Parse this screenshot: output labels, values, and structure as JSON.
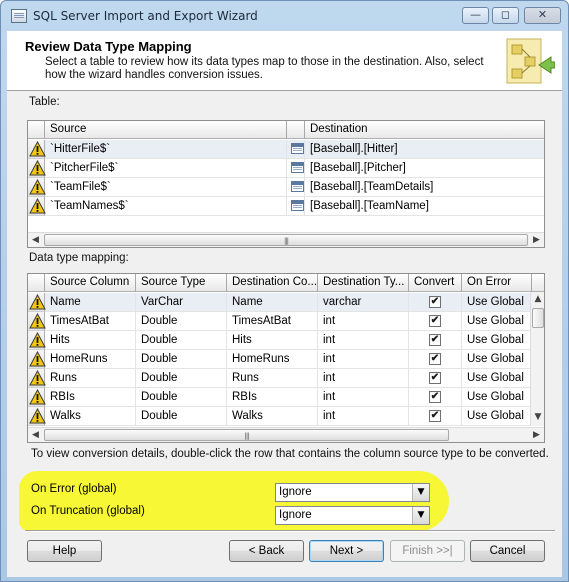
{
  "window": {
    "title": "SQL Server Import and Export Wizard"
  },
  "header": {
    "title": "Review Data Type Mapping",
    "description": "Select a table to review how its data types map to those in the destination. Also, select how the wizard handles conversion issues."
  },
  "tables": {
    "label": "Table:",
    "columns": [
      "Source",
      "Destination"
    ],
    "rows": [
      {
        "source": "`HitterFile$`",
        "destination": "[Baseball].[Hitter]",
        "warning": true
      },
      {
        "source": "`PitcherFile$`",
        "destination": "[Baseball].[Pitcher]",
        "warning": true
      },
      {
        "source": "`TeamFile$`",
        "destination": "[Baseball].[TeamDetails]",
        "warning": true
      },
      {
        "source": "`TeamNames$`",
        "destination": "[Baseball].[TeamName]",
        "warning": true
      }
    ]
  },
  "mapping": {
    "label": "Data type mapping:",
    "columns": [
      "Source Column",
      "Source Type",
      "Destination Co...",
      "Destination Ty...",
      "Convert",
      "On Error"
    ],
    "rows": [
      {
        "source_column": "Name",
        "source_type": "VarChar",
        "dest_column": "Name",
        "dest_type": "varchar",
        "convert": true,
        "on_error": "Use Global"
      },
      {
        "source_column": "TimesAtBat",
        "source_type": "Double",
        "dest_column": "TimesAtBat",
        "dest_type": "int",
        "convert": true,
        "on_error": "Use Global"
      },
      {
        "source_column": "Hits",
        "source_type": "Double",
        "dest_column": "Hits",
        "dest_type": "int",
        "convert": true,
        "on_error": "Use Global"
      },
      {
        "source_column": "HomeRuns",
        "source_type": "Double",
        "dest_column": "HomeRuns",
        "dest_type": "int",
        "convert": true,
        "on_error": "Use Global"
      },
      {
        "source_column": "Runs",
        "source_type": "Double",
        "dest_column": "Runs",
        "dest_type": "int",
        "convert": true,
        "on_error": "Use Global"
      },
      {
        "source_column": "RBIs",
        "source_type": "Double",
        "dest_column": "RBIs",
        "dest_type": "int",
        "convert": true,
        "on_error": "Use Global"
      },
      {
        "source_column": "Walks",
        "source_type": "Double",
        "dest_column": "Walks",
        "dest_type": "int",
        "convert": true,
        "on_error": "Use Global"
      }
    ]
  },
  "hint": "To view conversion details, double-click the row that contains the column source type to be converted.",
  "global": {
    "on_error_label": "On Error (global)",
    "on_error_value": "Ignore",
    "on_truncation_label": "On Truncation (global)",
    "on_truncation_value": "Ignore"
  },
  "buttons": {
    "help": "Help",
    "back": "< Back",
    "next": "Next >",
    "finish": "Finish >>|",
    "cancel": "Cancel"
  },
  "icons": {
    "warning": "warning-triangle-icon",
    "table": "table-icon",
    "checkbox": "checkmark"
  },
  "colors": {
    "highlight": "#f7f735",
    "warning": "#f3c613"
  }
}
